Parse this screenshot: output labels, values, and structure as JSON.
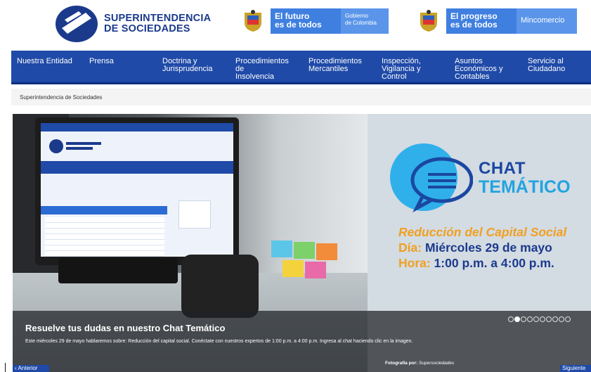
{
  "header": {
    "logo_text_line1": "SUPERINTENDENCIA",
    "logo_text_line2": "DE SOCIEDADES",
    "gov1": {
      "tagline_line1": "El futuro",
      "tagline_line2": "es de todos",
      "entity_line1": "Gobierno",
      "entity_line2": "de Colombia"
    },
    "gov2": {
      "tagline_line1": "El progreso",
      "tagline_line2": "es de todos",
      "entity": "Mincomercio"
    }
  },
  "nav": {
    "items": [
      {
        "line1": "Nuestra Entidad",
        "line2": "",
        "line3": ""
      },
      {
        "line1": "Prensa",
        "line2": "",
        "line3": ""
      },
      {
        "line1": "Doctrina y",
        "line2": "Jurisprudencia",
        "line3": ""
      },
      {
        "line1": "Procedimientos de",
        "line2": "Insolvencia",
        "line3": ""
      },
      {
        "line1": "Procedimientos",
        "line2": "Mercantiles",
        "line3": ""
      },
      {
        "line1": "Inspección,",
        "line2": "Vigilancia y",
        "line3": "Control"
      },
      {
        "line1": "Asuntos",
        "line2": "Económicos y",
        "line3": "Contables"
      },
      {
        "line1": "Servicio al",
        "line2": "Ciudadano",
        "line3": ""
      }
    ]
  },
  "breadcrumb": "Superintendencia de Sociedades",
  "slide": {
    "chat_word": "CHAT",
    "tematico_word": "TEMÁTICO",
    "subtitle": "Reducción del Capital Social",
    "day_label": "Día:",
    "day_value": "Miércoles 29 de mayo",
    "hour_label": "Hora:",
    "hour_value": "1:00 p.m. a 4:00 p.m.",
    "caption_title": "Resuelve tus dudas en nuestro Chat Temático",
    "caption_text": "Este miércoles 29 de mayo hablaremos sobre: Reducción del capital social. Conéctate con nuestros expertos de 1:00 p.m. a 4:00 p.m. Ingresa al chat haciendo clic en la imagen.",
    "credit_label": "Fotografía por:",
    "credit_value": "Supersociedades",
    "dot_count": 10,
    "active_dot": 1
  },
  "controls": {
    "prev_label": "Anterior",
    "prev_arrow": "‹",
    "next_label": "Siguiente"
  },
  "colors": {
    "brand_blue": "#1f4aa8",
    "accent_orange": "#f0a020",
    "accent_cyan": "#22a4e0"
  }
}
